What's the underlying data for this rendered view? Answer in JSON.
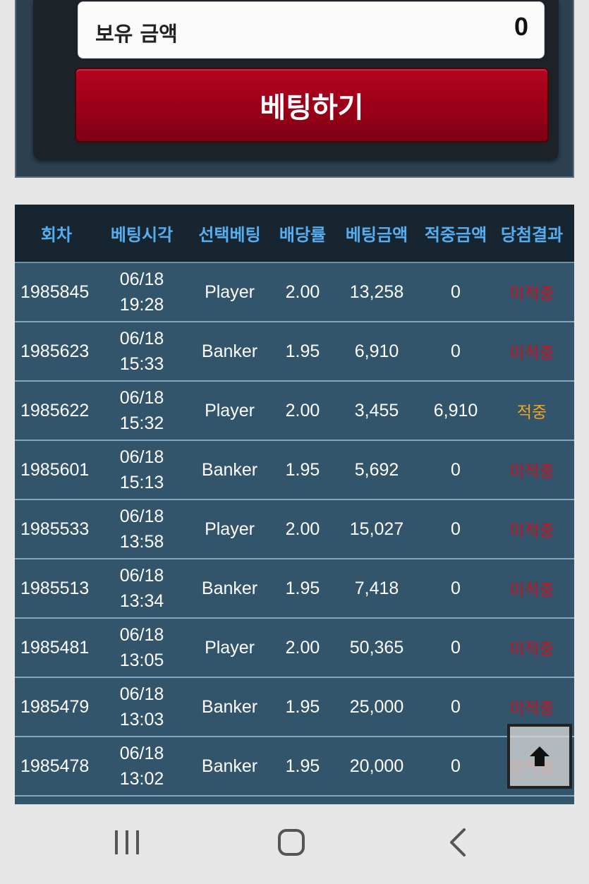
{
  "balance": {
    "label": "보유 금액",
    "value": "0"
  },
  "bet_button": {
    "label": "베팅하기"
  },
  "history": {
    "headers": [
      "회차",
      "베팅시각",
      "선택베팅",
      "배당률",
      "베팅금액",
      "적중금액",
      "당첨결과"
    ],
    "rows": [
      {
        "round": "1985845",
        "date": "06/18",
        "time": "19:28",
        "pick": "Player",
        "odds": "2.00",
        "bet": "13,258",
        "win": "0",
        "result": "미적중",
        "status": "lose"
      },
      {
        "round": "1985623",
        "date": "06/18",
        "time": "15:33",
        "pick": "Banker",
        "odds": "1.95",
        "bet": "6,910",
        "win": "0",
        "result": "미적중",
        "status": "lose"
      },
      {
        "round": "1985622",
        "date": "06/18",
        "time": "15:32",
        "pick": "Player",
        "odds": "2.00",
        "bet": "3,455",
        "win": "6,910",
        "result": "적중",
        "status": "win"
      },
      {
        "round": "1985601",
        "date": "06/18",
        "time": "15:13",
        "pick": "Banker",
        "odds": "1.95",
        "bet": "5,692",
        "win": "0",
        "result": "미적중",
        "status": "lose"
      },
      {
        "round": "1985533",
        "date": "06/18",
        "time": "13:58",
        "pick": "Player",
        "odds": "2.00",
        "bet": "15,027",
        "win": "0",
        "result": "미적중",
        "status": "lose"
      },
      {
        "round": "1985513",
        "date": "06/18",
        "time": "13:34",
        "pick": "Banker",
        "odds": "1.95",
        "bet": "7,418",
        "win": "0",
        "result": "미적중",
        "status": "lose"
      },
      {
        "round": "1985481",
        "date": "06/18",
        "time": "13:05",
        "pick": "Player",
        "odds": "2.00",
        "bet": "50,365",
        "win": "0",
        "result": "미적중",
        "status": "lose"
      },
      {
        "round": "1985479",
        "date": "06/18",
        "time": "13:03",
        "pick": "Banker",
        "odds": "1.95",
        "bet": "25,000",
        "win": "0",
        "result": "미적중",
        "status": "lose"
      },
      {
        "round": "1985478",
        "date": "06/18",
        "time": "13:02",
        "pick": "Banker",
        "odds": "1.95",
        "bet": "20,000",
        "win": "0",
        "result": "미적중",
        "status": "lose"
      }
    ]
  },
  "colors": {
    "header_text": "#55aef0",
    "lose": "#c8121e",
    "win": "#f2a41c",
    "button": "#a0001a"
  },
  "icons": {
    "scroll_top": "arrow-up-icon",
    "nav_recent": "recent-apps-icon",
    "nav_home": "home-icon",
    "nav_back": "back-icon"
  }
}
